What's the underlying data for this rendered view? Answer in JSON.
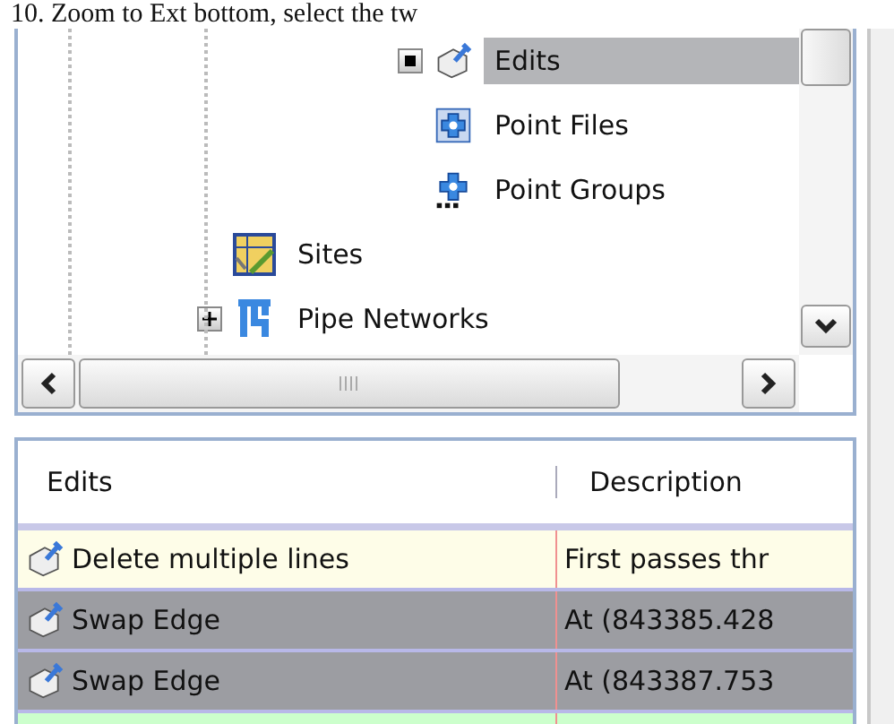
{
  "caption": "10. Zoom to Ext bottom, select the tw",
  "tree": {
    "items": [
      {
        "children": [
          {
            "label": "Edits",
            "kind": "edits",
            "expanded": true,
            "selected": true
          },
          {
            "label": "Point Files",
            "kind": "point-files",
            "selected": false
          },
          {
            "label": "Point Groups",
            "kind": "point-groups",
            "selected": false
          }
        ]
      },
      {
        "label": "Sites",
        "kind": "sites",
        "selected": false
      },
      {
        "label": "Pipe Networks",
        "kind": "pipe-networks",
        "expanded": false,
        "selected": false
      }
    ]
  },
  "table": {
    "columns": [
      "Edits",
      "Description"
    ],
    "rows": [
      {
        "kind": "edit",
        "color": "#fefde8",
        "selected": false,
        "cells": [
          "Delete multiple lines",
          "First passes thr"
        ]
      },
      {
        "kind": "edit",
        "selected": true,
        "cells": [
          "Swap Edge",
          "At (843385.428"
        ]
      },
      {
        "kind": "edit",
        "selected": true,
        "cells": [
          "Swap Edge",
          "At (843387.753"
        ]
      },
      {
        "kind": "new",
        "color": "#ccffcc",
        "selected": false,
        "cells": []
      }
    ]
  }
}
